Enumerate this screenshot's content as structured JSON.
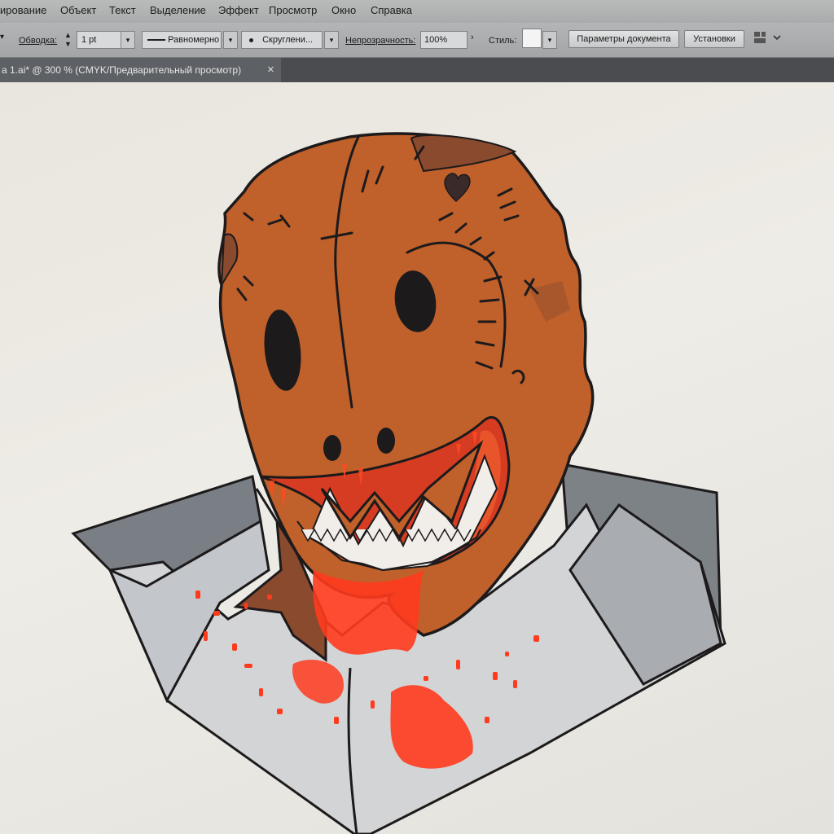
{
  "menubar": {
    "items": [
      "ирование",
      "Объект",
      "Текст",
      "Выделение",
      "Эффект",
      "Просмотр",
      "Окно",
      "Справка"
    ]
  },
  "control_bar": {
    "stroke_label": "Обводка:",
    "stroke_weight": "1 pt",
    "stroke_profile": "Равномерно",
    "brush": "Скруглени...",
    "opacity_label": "Непрозрачность:",
    "opacity_value": "100%",
    "style_label": "Стиль:",
    "document_setup_button": "Параметры документа",
    "preferences_button": "Установки",
    "arrange_icon": "arrange-documents-icon"
  },
  "document_tab": {
    "title": "а 1.ai* @ 300 % (CMYK/Предварительный просмотр)",
    "close_glyph": "×"
  },
  "artwork": {
    "subject": "scarecrow-masked-figure",
    "colors": {
      "mask": "#c0602a",
      "mask_shadow": "#8a4a2e",
      "outline": "#1d1a1c",
      "collar": "#7d8287",
      "collar_light": "#c3c6ca",
      "shirt": "#d2d4d6",
      "blood": "#ff3b1e",
      "mouth": "#d63c22",
      "teeth": "#f1eeea"
    }
  }
}
